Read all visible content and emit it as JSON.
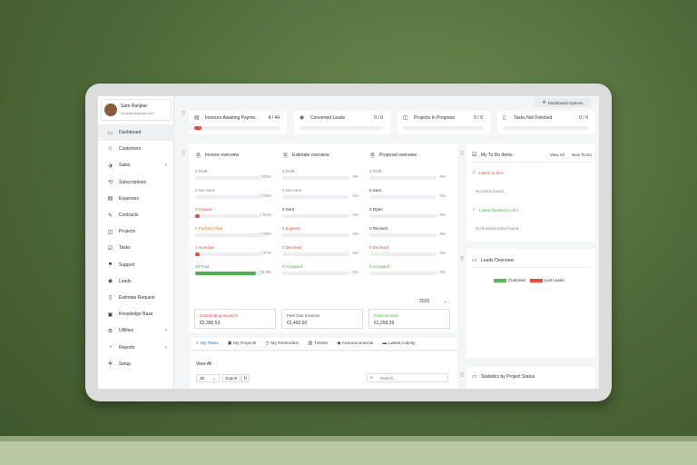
{
  "profile": {
    "name": "Sam Ranjbar",
    "email": "ranjsam@gmail.com"
  },
  "sidebar": {
    "items": [
      {
        "label": "Dashboard",
        "icon": "monitor-icon",
        "active": true
      },
      {
        "label": "Customers",
        "icon": "users-icon"
      },
      {
        "label": "Sales",
        "icon": "tag-icon",
        "chevron": true
      },
      {
        "label": "Subscriptions",
        "icon": "repeat-icon"
      },
      {
        "label": "Expenses",
        "icon": "receipt-icon"
      },
      {
        "label": "Contracts",
        "icon": "contract-icon"
      },
      {
        "label": "Projects",
        "icon": "layers-icon"
      },
      {
        "label": "Tasks",
        "icon": "check-square-icon"
      },
      {
        "label": "Support",
        "icon": "support-icon"
      },
      {
        "label": "Leads",
        "icon": "leads-icon"
      },
      {
        "label": "Estimate Request",
        "icon": "file-icon"
      },
      {
        "label": "Knowledge Base",
        "icon": "folder-icon"
      },
      {
        "label": "Utilities",
        "icon": "gear-icon",
        "chevron": true
      },
      {
        "label": "Reports",
        "icon": "pie-chart-icon",
        "chevron": true
      },
      {
        "label": "Setup",
        "icon": "settings-icon"
      }
    ]
  },
  "header": {
    "dashboard_options": "Dashboard Options"
  },
  "stats": [
    {
      "title": "Invoices Awaiting Payme..",
      "value": "4 / 44",
      "progress": 0.09
    },
    {
      "title": "Converted Leads",
      "value": "0 / 0",
      "progress": 0
    },
    {
      "title": "Projects In Progress",
      "value": "0 / 0",
      "progress": 0
    },
    {
      "title": "Tasks Not Finished",
      "value": "0 / 0",
      "progress": 0
    }
  ],
  "invoice_overview": {
    "title": "Invoice overview",
    "rows": [
      {
        "label": "0 Draft",
        "pct": "0.00%",
        "color": "#888888",
        "progress": 0
      },
      {
        "label": "0 Not Sent",
        "pct": "0.00%",
        "color": "#888888",
        "progress": 0
      },
      {
        "label": "3 Unpaid",
        "pct": "6.82%",
        "color": "#e74c3c",
        "progress": 0.068
      },
      {
        "label": "0 Partially Paid",
        "pct": "0.00%",
        "color": "#e67e22",
        "progress": 0
      },
      {
        "label": "1 Overdue",
        "pct": "2.27%",
        "color": "#e74c3c",
        "progress": 0.023
      },
      {
        "label": "40 Paid",
        "pct": "90.9%",
        "color": "#4caf50",
        "progress": 0.909
      }
    ]
  },
  "estimate_overview": {
    "title": "Estimate overview",
    "rows": [
      {
        "label": "0 Draft",
        "pct": "0%",
        "color": "#888888",
        "progress": 0
      },
      {
        "label": "0 Not Sent",
        "pct": "0%",
        "color": "#888888",
        "progress": 0
      },
      {
        "label": "0 Sent",
        "pct": "0%",
        "color": "#333333",
        "progress": 0
      },
      {
        "label": "0 Expired",
        "pct": "0%",
        "color": "#e74c3c",
        "progress": 0
      },
      {
        "label": "0 Declined",
        "pct": "0%",
        "color": "#e74c3c",
        "progress": 0
      },
      {
        "label": "0 Accepted",
        "pct": "0%",
        "color": "#4caf50",
        "progress": 0
      }
    ]
  },
  "proposal_overview": {
    "title": "Proposal overview",
    "rows": [
      {
        "label": "0 Draft",
        "pct": "0%",
        "color": "#888888",
        "progress": 0
      },
      {
        "label": "0 Sent",
        "pct": "0%",
        "color": "#333333",
        "progress": 0
      },
      {
        "label": "0 Open",
        "pct": "0%",
        "color": "#333333",
        "progress": 0
      },
      {
        "label": "0 Revised",
        "pct": "0%",
        "color": "#333333",
        "progress": 0
      },
      {
        "label": "0 Declined",
        "pct": "0%",
        "color": "#e74c3c",
        "progress": 0
      },
      {
        "label": "0 Accepted",
        "pct": "0%",
        "color": "#4caf50",
        "progress": 0
      }
    ]
  },
  "year": "2026",
  "summaries": [
    {
      "label": "Outstanding Invoices",
      "value": "€2,390.53",
      "color": "#e74c3c"
    },
    {
      "label": "Past Due Invoices",
      "value": "€1,492.00",
      "color": "#555555"
    },
    {
      "label": "Paid Invoices",
      "value": "€1,258.39",
      "color": "#4caf50"
    }
  ],
  "tabs": [
    {
      "label": "My Tasks",
      "icon": "list-icon",
      "active": true
    },
    {
      "label": "My Projects",
      "icon": "folder-icon"
    },
    {
      "label": "My Reminders",
      "icon": "clock-icon"
    },
    {
      "label": "Tickets",
      "icon": "ticket-icon"
    },
    {
      "label": "Announcements",
      "icon": "megaphone-icon"
    },
    {
      "label": "Latest Activity",
      "icon": "activity-icon"
    }
  ],
  "table_controls": {
    "view_all": "View All",
    "page_size": "25",
    "export": "Export",
    "search_placeholder": "Search..."
  },
  "todo": {
    "title": "My To Do Items",
    "view_all": "View All",
    "new_todo": "New To Do",
    "latest": "Latest to do's",
    "no_todos": "No todos found",
    "finished": "Latest finished to do's",
    "no_finished": "No finished todos found"
  },
  "leads": {
    "title": "Leads Overview",
    "legend": [
      {
        "label": "Customer",
        "color": "#5cb85c"
      },
      {
        "label": "Lost Leads",
        "color": "#e74c3c"
      }
    ]
  },
  "stats_by_project": {
    "title": "Statistics by Project Status"
  },
  "colors": {
    "accent": "#3478c6",
    "danger": "#e74c3c",
    "success": "#4caf50"
  }
}
